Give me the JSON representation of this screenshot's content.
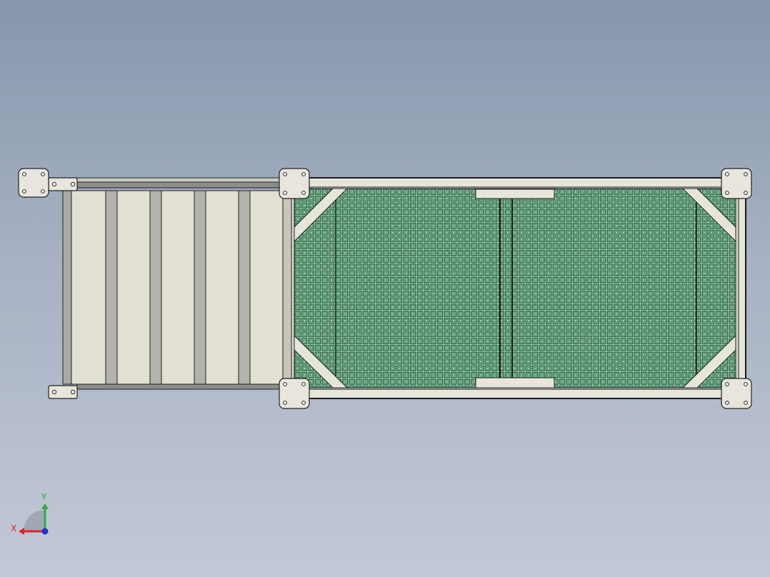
{
  "viewport": {
    "background_top": "#8796ac",
    "background_bottom": "#c2c9d7"
  },
  "model": {
    "frame_color": "#e6e5da",
    "outline_color": "#1a1a1a",
    "grid_fill": "#7fd3a0",
    "grid_line_color": "#303a33",
    "conveyor_plate_color": "#e1e0d3",
    "conveyor_bar_color": "#b3b3ae",
    "pad_color": "#e8e6dc"
  },
  "triad": {
    "x_label": "X",
    "y_label": "Y",
    "x_color": "#e0202a",
    "y_color": "#28b040",
    "z_color": "#2030c8"
  }
}
